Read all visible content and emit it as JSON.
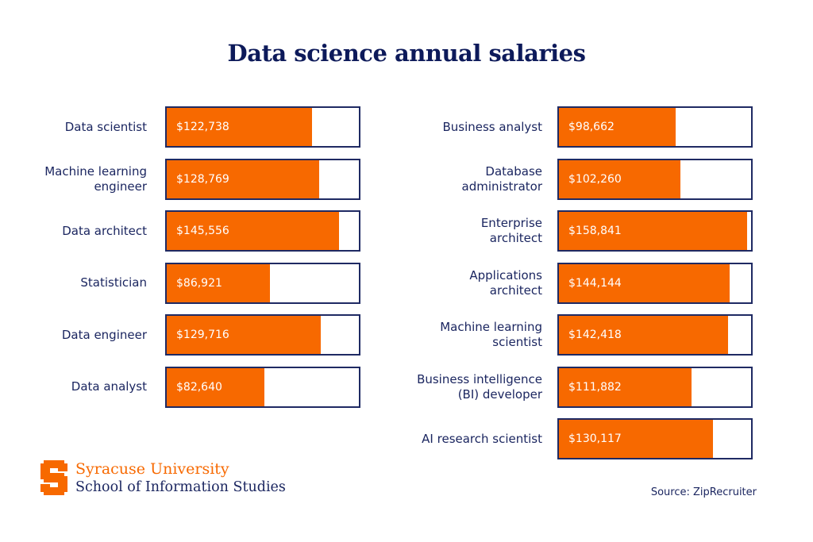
{
  "title": "Data science annual salaries",
  "chart_data": {
    "type": "bar",
    "orientation": "horizontal",
    "title": "Data science annual salaries",
    "xlabel": "",
    "ylabel": "",
    "xlim": [
      0,
      162000
    ],
    "grid": false,
    "colors": {
      "fill": "#f76900",
      "border": "#1f2a63",
      "label": "#1b2660"
    },
    "panels": [
      {
        "name": "left",
        "categories": [
          "Data scientist",
          "Machine learning engineer",
          "Data architect",
          "Statistician",
          "Data engineer",
          "Data analyst"
        ],
        "label_lines": [
          [
            "Data scientist"
          ],
          [
            "Machine learning",
            "engineer"
          ],
          [
            "Data architect"
          ],
          [
            "Statistician"
          ],
          [
            "Data engineer"
          ],
          [
            "Data analyst"
          ]
        ],
        "values": [
          122738,
          128769,
          145556,
          86921,
          129716,
          82640
        ],
        "value_labels": [
          "$122,738",
          "$128,769",
          "$145,556",
          "$86,921",
          "$129,716",
          "$82,640"
        ]
      },
      {
        "name": "right",
        "categories": [
          "Business analyst",
          "Database administrator",
          "Enterprise architect",
          "Applications architect",
          "Machine learning scientist",
          "Business intelligence (BI) developer",
          "AI research scientist"
        ],
        "label_lines": [
          [
            "Business analyst"
          ],
          [
            "Database",
            "administrator"
          ],
          [
            "Enterprise",
            "architect"
          ],
          [
            "Applications",
            "architect"
          ],
          [
            "Machine learning",
            "scientist"
          ],
          [
            "Business intelligence",
            "(BI) developer"
          ],
          [
            "AI research scientist"
          ]
        ],
        "values": [
          98662,
          102260,
          158841,
          144144,
          142418,
          111882,
          130117
        ],
        "value_labels": [
          "$98,662",
          "$102,260",
          "$158,841",
          "$144,144",
          "$142,418",
          "$111,882",
          "$130,117"
        ]
      }
    ]
  },
  "footer": {
    "logo_icon": "syracuse-s-logo",
    "org_name": "Syracuse University",
    "school_name": "School of Information Studies",
    "source": "Source: ZipRecruiter"
  }
}
